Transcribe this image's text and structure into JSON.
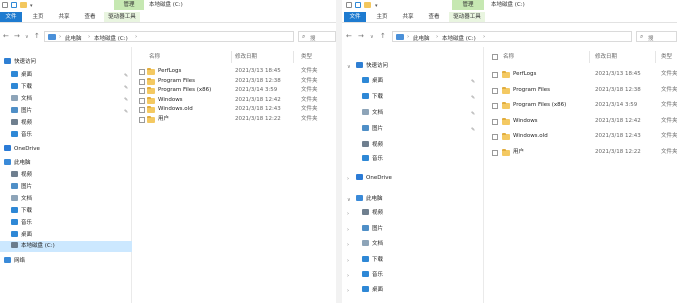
{
  "left": {
    "title": "本地磁盘 (C:)",
    "context_tab": "管理",
    "tabs": [
      "文件",
      "主页",
      "共享",
      "查看",
      "驱动器工具"
    ],
    "breadcrumb": [
      "此电脑",
      "本地磁盘 (C:)"
    ],
    "search_placeholder": "搜",
    "sidebar": [
      {
        "label": "快速访问",
        "icon": "star-icon",
        "color": "#2f7fd3"
      },
      {
        "label": "桌面",
        "icon": "desktop-icon",
        "color": "#2e88d6",
        "pinned": true
      },
      {
        "label": "下载",
        "icon": "download-icon",
        "color": "#2e88d6",
        "pinned": true
      },
      {
        "label": "文档",
        "icon": "document-icon",
        "color": "#8da4b8",
        "pinned": true
      },
      {
        "label": "图片",
        "icon": "picture-icon",
        "color": "#4f8fc7",
        "pinned": true
      },
      {
        "label": "视频",
        "icon": "video-icon",
        "color": "#6f7f8f"
      },
      {
        "label": "音乐",
        "icon": "music-icon",
        "color": "#2e88d6"
      },
      {
        "label": "OneDrive",
        "icon": "cloud-icon",
        "color": "#2b7bd6"
      },
      {
        "label": "此电脑",
        "icon": "pc-icon",
        "color": "#3a8ad8"
      },
      {
        "label": "视频",
        "icon": "video-icon",
        "color": "#6f7f8f"
      },
      {
        "label": "图片",
        "icon": "picture-icon",
        "color": "#4f8fc7"
      },
      {
        "label": "文档",
        "icon": "document-icon",
        "color": "#8da4b8"
      },
      {
        "label": "下载",
        "icon": "download-icon",
        "color": "#2e88d6"
      },
      {
        "label": "音乐",
        "icon": "music-icon",
        "color": "#2e88d6"
      },
      {
        "label": "桌面",
        "icon": "desktop-icon",
        "color": "#2e88d6"
      },
      {
        "label": "本地磁盘 (C:)",
        "icon": "drive-icon",
        "color": "#6b7c8c",
        "selected": true
      },
      {
        "label": "网络",
        "icon": "network-icon",
        "color": "#3a8ad8"
      }
    ],
    "columns": {
      "name": "名称",
      "date": "修改日期",
      "type": "类型"
    },
    "rows": [
      {
        "name": "PerfLogs",
        "date": "2021/3/13 18:45",
        "type": "文件夹"
      },
      {
        "name": "Program Files",
        "date": "2021/3/18 12:38",
        "type": "文件夹"
      },
      {
        "name": "Program Files (x86)",
        "date": "2021/3/14 3:59",
        "type": "文件夹"
      },
      {
        "name": "Windows",
        "date": "2021/3/18 12:42",
        "type": "文件夹"
      },
      {
        "name": "Windows.old",
        "date": "2021/3/18 12:43",
        "type": "文件夹"
      },
      {
        "name": "用户",
        "date": "2021/3/18 12:22",
        "type": "文件夹"
      }
    ]
  },
  "right": {
    "title": "本地磁盘 (C:)",
    "context_tab": "管理",
    "tabs": [
      "文件",
      "主页",
      "共享",
      "查看",
      "驱动器工具"
    ],
    "breadcrumb": [
      "此电脑",
      "本地磁盘 (C:)"
    ],
    "search_placeholder": "搜",
    "sidebar": [
      {
        "label": "快速访问",
        "icon": "star-icon",
        "color": "#2f7fd3"
      },
      {
        "label": "桌面",
        "icon": "desktop-icon",
        "color": "#2e88d6",
        "pinned": true
      },
      {
        "label": "下载",
        "icon": "download-icon",
        "color": "#2e88d6",
        "pinned": true
      },
      {
        "label": "文档",
        "icon": "document-icon",
        "color": "#8da4b8",
        "pinned": true
      },
      {
        "label": "图片",
        "icon": "picture-icon",
        "color": "#4f8fc7",
        "pinned": true
      },
      {
        "label": "视频",
        "icon": "video-icon",
        "color": "#6f7f8f"
      },
      {
        "label": "音乐",
        "icon": "music-icon",
        "color": "#2e88d6"
      },
      {
        "label": "OneDrive",
        "icon": "cloud-icon",
        "color": "#2b7bd6"
      },
      {
        "label": "此电脑",
        "icon": "pc-icon",
        "color": "#3a8ad8"
      },
      {
        "label": "视频",
        "icon": "video-icon",
        "color": "#6f7f8f"
      },
      {
        "label": "图片",
        "icon": "picture-icon",
        "color": "#4f8fc7"
      },
      {
        "label": "文档",
        "icon": "document-icon",
        "color": "#8da4b8"
      },
      {
        "label": "下载",
        "icon": "download-icon",
        "color": "#2e88d6"
      },
      {
        "label": "音乐",
        "icon": "music-icon",
        "color": "#2e88d6"
      },
      {
        "label": "桌面",
        "icon": "desktop-icon",
        "color": "#2e88d6"
      }
    ],
    "columns": {
      "name": "名称",
      "date": "修改日期",
      "type": "类型"
    },
    "rows": [
      {
        "name": "PerfLogs",
        "date": "2021/3/13 18:45",
        "type": "文件夹"
      },
      {
        "name": "Program Files",
        "date": "2021/3/18 12:38",
        "type": "文件夹"
      },
      {
        "name": "Program Files (x86)",
        "date": "2021/3/14 3:59",
        "type": "文件夹"
      },
      {
        "name": "Windows",
        "date": "2021/3/18 12:42",
        "type": "文件夹"
      },
      {
        "name": "Windows.old",
        "date": "2021/3/18 12:43",
        "type": "文件夹"
      },
      {
        "name": "用户",
        "date": "2021/3/18 12:22",
        "type": "文件夹"
      }
    ]
  }
}
